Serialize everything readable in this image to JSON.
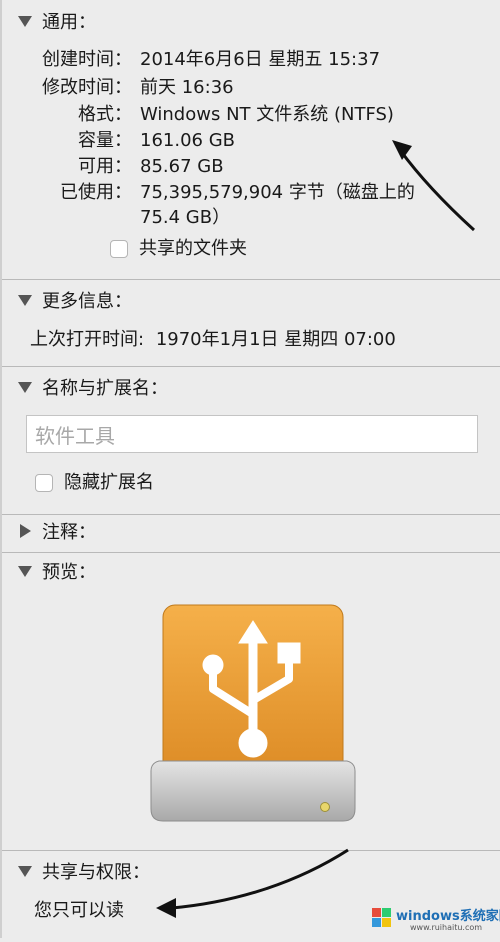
{
  "general": {
    "header": "通用：",
    "fields": [
      {
        "label": "创建时间：",
        "value": "2014年6月6日 星期五 15:37"
      },
      {
        "label": "修改时间：",
        "value": "前天 16:36"
      },
      {
        "label": "格式：",
        "value": "Windows NT 文件系统 (NTFS)"
      },
      {
        "label": "容量：",
        "value": "161.06 GB"
      },
      {
        "label": "可用：",
        "value": "85.67 GB"
      },
      {
        "label": "已使用：",
        "value": "75,395,579,904 字节（磁盘上的",
        "value2": "75.4 GB）"
      }
    ],
    "shared_folder_label": "共享的文件夹"
  },
  "more_info": {
    "header": "更多信息：",
    "last_opened_label": "上次打开时间:",
    "last_opened_value": "1970年1月1日 星期四 07:00"
  },
  "name_ext": {
    "header": "名称与扩展名：",
    "name_value": "软件工具",
    "hide_ext_label": "隐藏扩展名"
  },
  "comments": {
    "header": "注释："
  },
  "preview": {
    "header": "预览："
  },
  "sharing": {
    "header": "共享与权限：",
    "status": "您只可以读"
  },
  "watermark": {
    "brand": "windows系统家园",
    "url": "www.ruihaitu.com"
  },
  "colors": {
    "drive_orange": "#f0a43a",
    "drive_orange_dark": "#d98a22",
    "drive_gray": "#c9c9c9",
    "led": "#e8d66a"
  }
}
